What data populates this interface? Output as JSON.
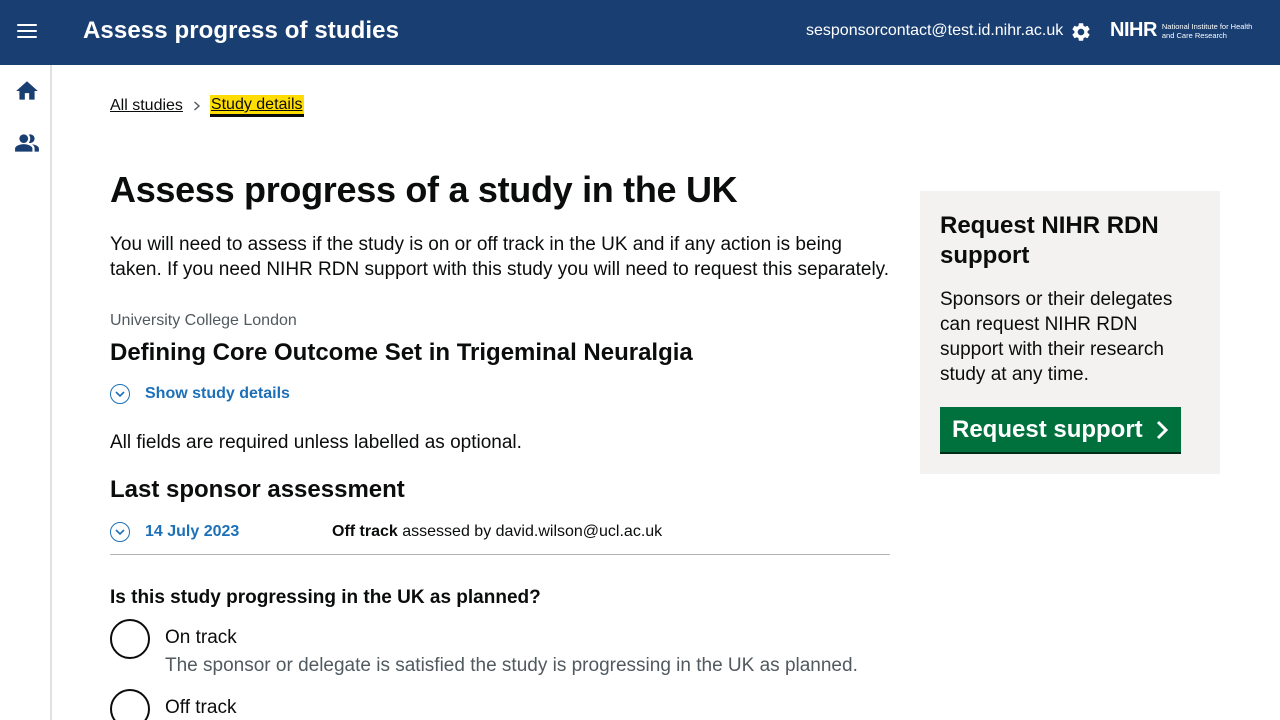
{
  "header": {
    "title": "Assess progress of studies",
    "user_email": "sesponsorcontact@test.id.nihr.ac.uk",
    "logo_mark": "NIHR",
    "logo_text": "National Institute for Health and Care Research",
    "menu_icon": "hamburger-menu-icon",
    "settings_icon": "gear-icon",
    "background_color": "#193e72"
  },
  "sidebar": {
    "items": [
      {
        "icon": "home-icon"
      },
      {
        "icon": "people-icon"
      }
    ]
  },
  "breadcrumb": {
    "items": [
      "All studies",
      "Study details"
    ]
  },
  "main": {
    "title": "Assess progress of a study in the UK",
    "intro": "You will need to assess if the study is on or off track in the UK and if any action is being taken. If you need NIHR RDN support with this study you will need to request this separately.",
    "organisation": "University College London",
    "study_title": "Defining Core Outcome Set in Trigeminal Neuralgia",
    "show_details_label": "Show study details",
    "required_note": "All fields are required unless labelled as optional.",
    "last_assessment_heading": "Last sponsor assessment",
    "last_assessment": {
      "date": "14 July 2023",
      "status": "Off track",
      "assessed_by_text": "assessed by david.wilson@ucl.ac.uk"
    },
    "question": "Is this study progressing in the UK as planned?",
    "options": [
      {
        "label": "On track",
        "hint": "The sponsor or delegate is satisfied the study is progressing in the UK as planned."
      },
      {
        "label": "Off track",
        "hint": ""
      }
    ]
  },
  "panel": {
    "title": "Request NIHR RDN support",
    "text": "Sponsors or their delegates can request NIHR RDN support with their research study at any time.",
    "button_label": "Request support"
  },
  "colors": {
    "link": "#1d70b8",
    "button": "#00703c",
    "highlight": "#ffdd00",
    "panel_bg": "#f3f2f1"
  }
}
